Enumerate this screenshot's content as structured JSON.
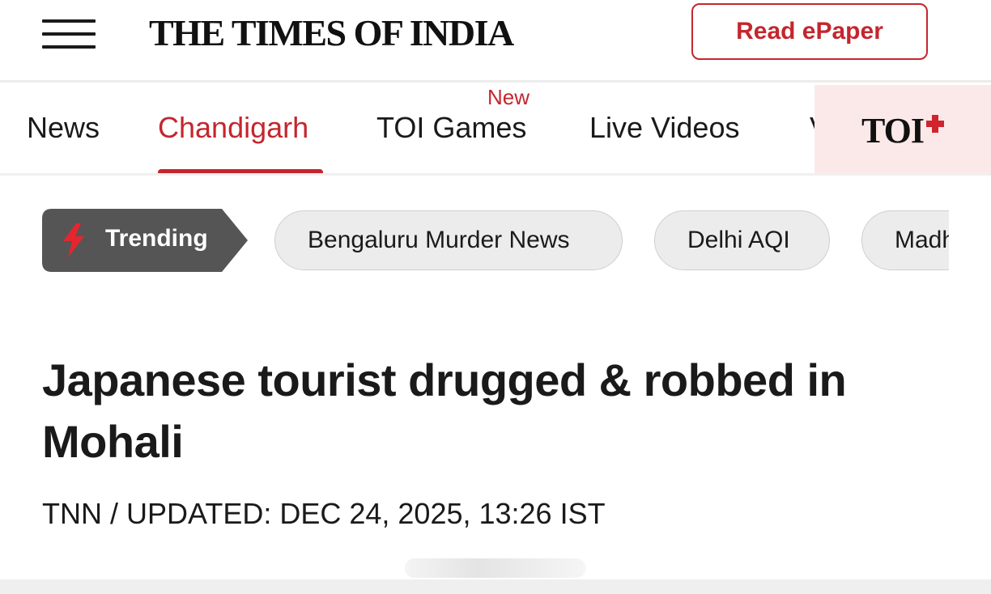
{
  "header": {
    "logo": "THE TIMES OF INDIA",
    "epaper_label": "Read ePaper"
  },
  "nav": {
    "tabs": [
      {
        "label": "News"
      },
      {
        "label": "Chandigarh"
      },
      {
        "label": "TOI Games"
      },
      {
        "label": "Live Videos"
      },
      {
        "label": "V"
      }
    ],
    "active_tab": "Chandigarh",
    "new_badge": "New",
    "toi_plus_label": "TOI"
  },
  "trending": {
    "label": "Trending",
    "pills": [
      {
        "label": "Bengaluru Murder News"
      },
      {
        "label": "Delhi AQI"
      },
      {
        "label": "Madhya"
      }
    ]
  },
  "article": {
    "headline": "Japanese tourist drugged & robbed in Mohali",
    "byline": "TNN / UPDATED: DEC 24, 2025, 13:26 IST"
  },
  "colors": {
    "accent": "#c4262e",
    "trending_bg": "#555555",
    "pill_bg": "#ececec",
    "toi_plus_bg": "#fbe9e9"
  },
  "icons": [
    "menu-icon",
    "bolt-icon",
    "plus-icon"
  ]
}
